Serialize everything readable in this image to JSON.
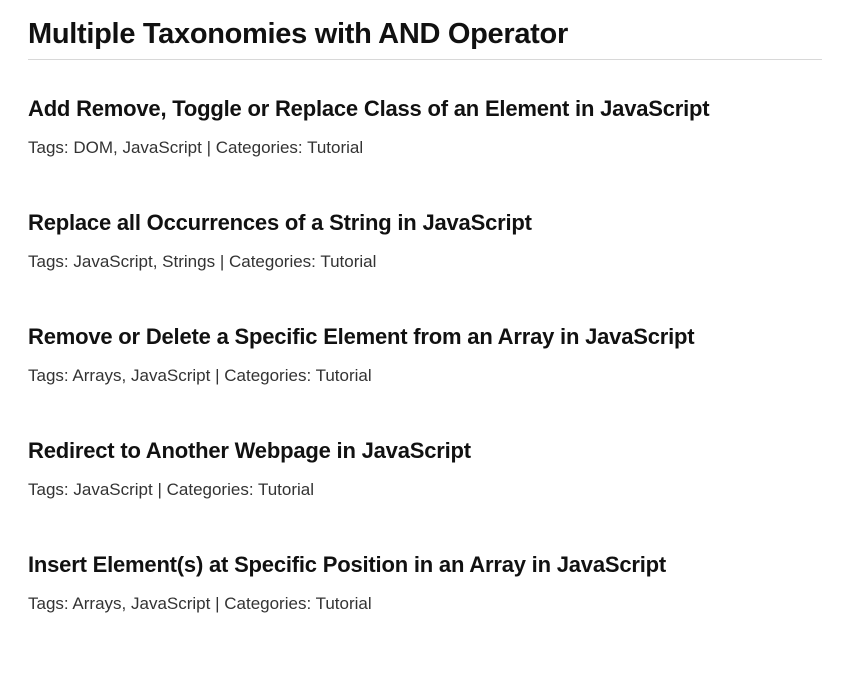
{
  "page_title": "Multiple Taxonomies with AND Operator",
  "labels": {
    "tags_prefix": "Tags: ",
    "categories_prefix": "Categories: ",
    "separator": " | "
  },
  "posts": [
    {
      "title": "Add Remove, Toggle or Replace Class of an Element in JavaScript",
      "tags": "DOM, JavaScript",
      "categories": "Tutorial"
    },
    {
      "title": "Replace all Occurrences of a String in JavaScript",
      "tags": "JavaScript, Strings",
      "categories": "Tutorial"
    },
    {
      "title": "Remove or Delete a Specific Element from an Array in JavaScript",
      "tags": "Arrays, JavaScript",
      "categories": "Tutorial"
    },
    {
      "title": "Redirect to Another Webpage in JavaScript",
      "tags": "JavaScript",
      "categories": "Tutorial"
    },
    {
      "title": "Insert Element(s) at Specific Position in an Array in JavaScript",
      "tags": "Arrays, JavaScript",
      "categories": "Tutorial"
    }
  ]
}
